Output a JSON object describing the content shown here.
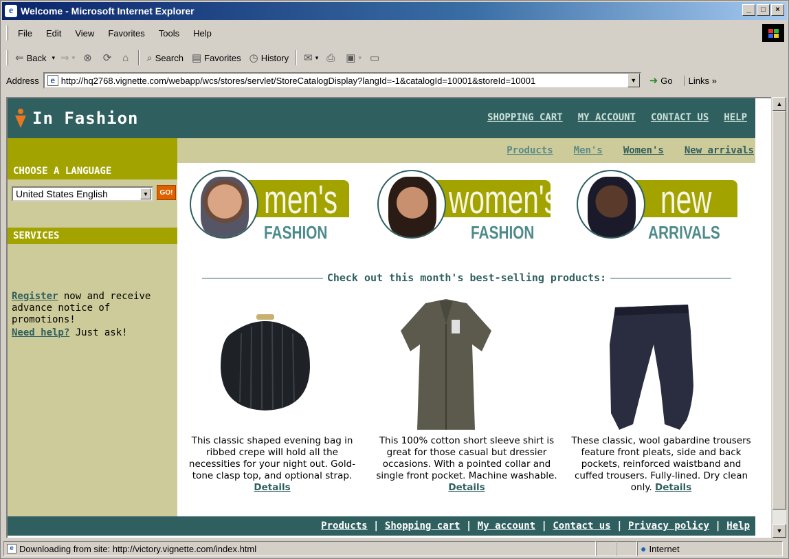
{
  "window": {
    "title": "Welcome - Microsoft Internet Explorer"
  },
  "menu": [
    "File",
    "Edit",
    "View",
    "Favorites",
    "Tools",
    "Help"
  ],
  "toolbar": {
    "back": "Back",
    "search": "Search",
    "favorites": "Favorites",
    "history": "History"
  },
  "address": {
    "label": "Address",
    "url": "http://hq2768.vignette.com/webapp/wcs/stores/servlet/StoreCatalogDisplay?langId=-1&catalogId=10001&storeId=10001",
    "go": "Go",
    "links": "Links »"
  },
  "site": {
    "logo": "In Fashion",
    "top_links": [
      "SHOPPING CART",
      "MY ACCOUNT",
      "CONTACT US",
      "HELP"
    ],
    "nav": [
      "Products",
      "Men's",
      "Women's",
      "New arrivals"
    ],
    "sidebar": {
      "language_heading": "CHOOSE A LANGUAGE",
      "language_value": "United States English",
      "go": "GO!",
      "services_heading": "SERVICES",
      "register_link": "Register",
      "register_text": " now and receive advance notice of promotions!",
      "help_link": "Need help?",
      "help_text": " Just ask!"
    },
    "banners": [
      {
        "big": "men's",
        "small": "FASHION"
      },
      {
        "big": "women's",
        "small": "FASHION"
      },
      {
        "big": "new",
        "small": "ARRIVALS"
      }
    ],
    "best_selling": "Check out this month's best-selling products:",
    "products": [
      {
        "desc": "This classic shaped evening bag in ribbed crepe will hold all the necessities for your night out. Gold-tone clasp top, and optional strap.",
        "link": "Details"
      },
      {
        "desc": "This 100% cotton short sleeve shirt is great for those casual but dressier occasions. With a pointed collar and single front pocket. Machine washable.",
        "link": "Details"
      },
      {
        "desc": "These classic, wool gabardine trousers feature front pleats, side and back pockets, reinforced waistband and cuffed trousers. Fully-lined. Dry clean only.",
        "link": "Details"
      }
    ],
    "footer_links": [
      "Products",
      "Shopping cart",
      "My account",
      "Contact us",
      "Privacy policy",
      "Help"
    ]
  },
  "status": {
    "text": "Downloading from site: http://victory.vignette.com/index.html",
    "zone": "Internet"
  },
  "colors": {
    "teal": "#2f5f5f",
    "olive": "#a3a300",
    "khaki": "#cdcb9a"
  }
}
